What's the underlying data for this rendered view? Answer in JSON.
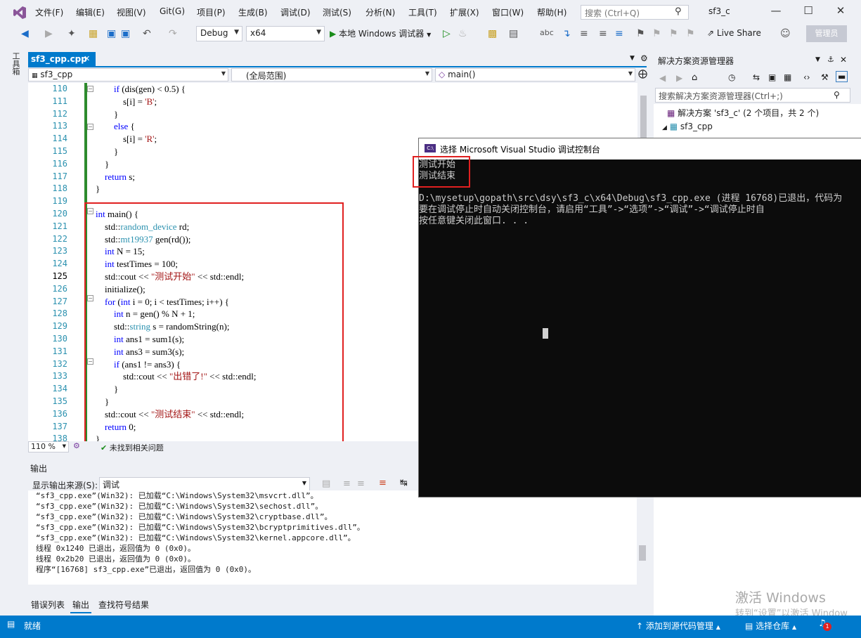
{
  "menu": {
    "items": [
      "文件(F)",
      "编辑(E)",
      "视图(V)",
      "Git(G)",
      "项目(P)",
      "生成(B)",
      "调试(D)",
      "测试(S)",
      "分析(N)",
      "工具(T)",
      "扩展(X)",
      "窗口(W)",
      "帮助(H)"
    ],
    "search_placeholder": "搜索 (Ctrl+Q)",
    "solution_name": "sf3_c"
  },
  "toolbar": {
    "config": "Debug",
    "platform": "x64",
    "run_label": "本地 Windows 调试器",
    "liveshare": "Live Share",
    "admin": "管理员"
  },
  "left_strip": {
    "toolbox": "工具箱"
  },
  "editor": {
    "tab_name": "sf3_cpp.cpp",
    "nav_project": "sf3_cpp",
    "nav_scope": "(全局范围)",
    "nav_member": "main()",
    "line_numbers": [
      "110",
      "111",
      "112",
      "113",
      "114",
      "115",
      "116",
      "117",
      "118",
      "119",
      "120",
      "121",
      "122",
      "123",
      "124",
      "125",
      "126",
      "127",
      "128",
      "129",
      "130",
      "131",
      "132",
      "133",
      "134",
      "135",
      "136",
      "137",
      "138"
    ],
    "zoom": "110 %",
    "issues": "未找到相关问题"
  },
  "output": {
    "title": "输出",
    "source_label": "显示输出来源(S):",
    "source_value": "调试",
    "lines": [
      "“sf3_cpp.exe”(Win32): 已加载“C:\\Windows\\System32\\msvcrt.dll”。",
      "“sf3_cpp.exe”(Win32): 已加载“C:\\Windows\\System32\\sechost.dll”。",
      "“sf3_cpp.exe”(Win32): 已加载“C:\\Windows\\System32\\cryptbase.dll”。",
      "“sf3_cpp.exe”(Win32): 已加载“C:\\Windows\\System32\\bcryptprimitives.dll”。",
      "“sf3_cpp.exe”(Win32): 已加载“C:\\Windows\\System32\\kernel.appcore.dll”。",
      "线程 0x1240 已退出，返回值为 0 (0x0)。",
      "线程 0x2b20 已退出，返回值为 0 (0x0)。",
      "程序“[16768] sf3_cpp.exe”已退出，返回值为 0 (0x0)。"
    ],
    "tabs": [
      "错误列表",
      "输出",
      "查找符号结果"
    ]
  },
  "solution_explorer": {
    "title": "解决方案资源管理器",
    "search_placeholder": "搜索解决方案资源管理器(Ctrl+;)",
    "solution_node": "解决方案 'sf3_c' (2 个项目，共 2 个)",
    "project_node": "sf3_cpp"
  },
  "console": {
    "title": "选择 Microsoft Visual Studio 调试控制台",
    "lines": [
      "测试开始",
      "测试结束",
      "",
      "D:\\mysetup\\gopath\\src\\dsy\\sf3_c\\x64\\Debug\\sf3_cpp.exe (进程 16768)已退出，代码为",
      "要在调试停止时自动关闭控制台，请启用“工具”->“选项”->“调试”->“调试停止时自",
      "按任意键关闭此窗口. . ."
    ]
  },
  "watermark": {
    "line1": "激活 Windows",
    "line2": "转到“设置”以激活 Window"
  },
  "statusbar": {
    "ready": "就绪",
    "add_source": "添加到源代码管理",
    "select_repo": "选择仓库",
    "notifications": "1"
  },
  "colors": {
    "accent": "#007acc",
    "highlight_box": "#e02020",
    "console_bg": "#0c0c0c"
  }
}
